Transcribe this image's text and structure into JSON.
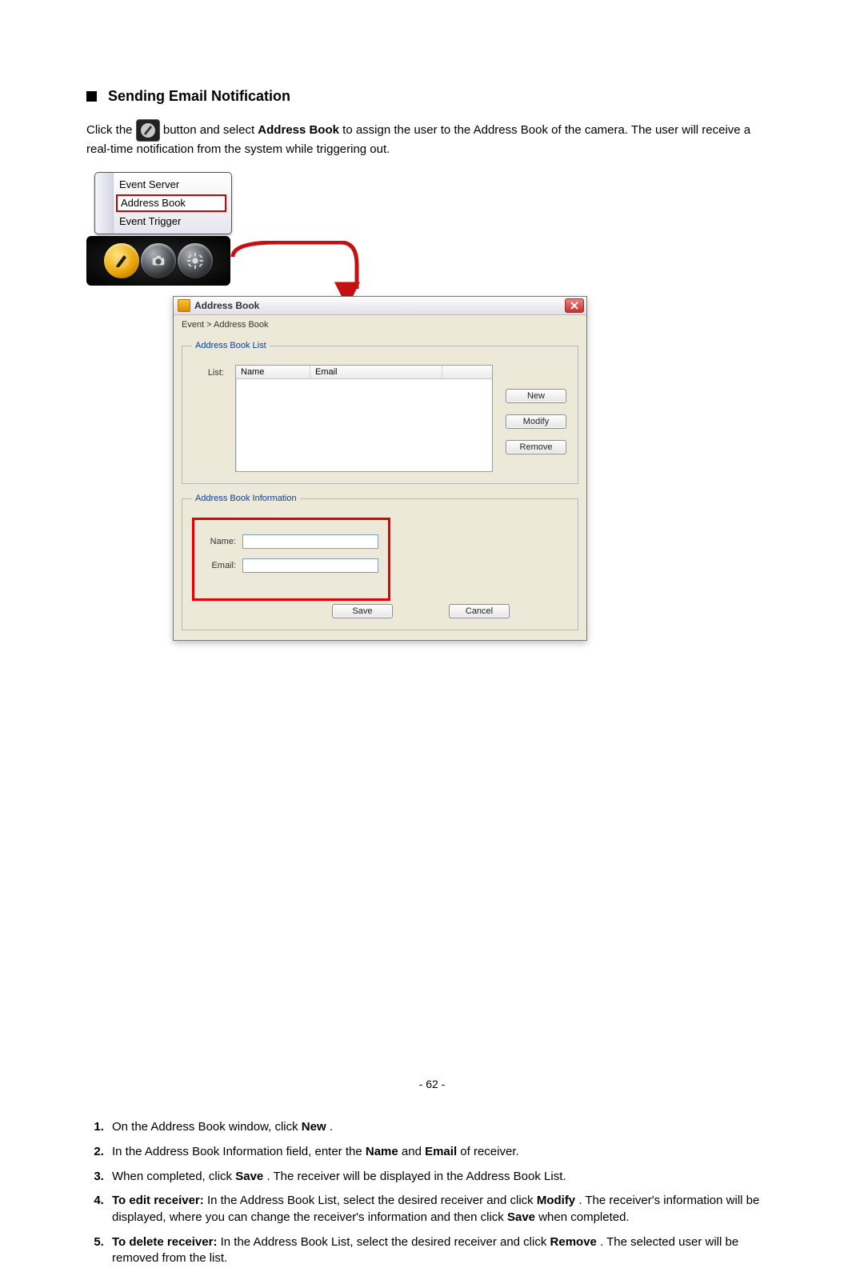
{
  "heading": "Sending Email Notification",
  "intro": {
    "t1": "Click the ",
    "t2": " button and select ",
    "bold1": "Address Book",
    "t3": " to assign the user to the Address Book of the camera. The user will receive a real-time notification from the system while triggering out."
  },
  "menu": {
    "items": [
      "Event Server",
      "Address Book",
      "Event Trigger"
    ],
    "selected": "Address Book"
  },
  "icon_strip": {
    "pen": "pen-icon",
    "camera": "camera-icon",
    "gear": "gear-icon"
  },
  "dialog": {
    "title": "Address Book",
    "breadcrumb": "Event > Address Book",
    "group_list_legend": "Address Book List",
    "list_label": "List:",
    "columns": {
      "name": "Name",
      "email": "Email"
    },
    "buttons": {
      "new": "New",
      "modify": "Modify",
      "remove": "Remove"
    },
    "group_info_legend": "Address Book Information",
    "fields": {
      "name_label": "Name:",
      "email_label": "Email:",
      "name_value": "",
      "email_value": ""
    },
    "bottom": {
      "save": "Save",
      "cancel": "Cancel"
    }
  },
  "steps": {
    "s1a": "On the Address Book window, click ",
    "s1b": "New",
    "s1c": ".",
    "s2a": "In the Address Book Information field, enter the ",
    "s2b": "Name",
    "s2c": " and ",
    "s2d": "Email",
    "s2e": " of receiver.",
    "s3a": "When completed, click ",
    "s3b": "Save",
    "s3c": ". The receiver will be displayed in the Address Book List.",
    "s4a": "To edit receiver:",
    "s4b": " In the Address Book List, select the desired receiver and click ",
    "s4c": "Modify",
    "s4d": ". The receiver's information will be displayed, where you can change the receiver's information and then click ",
    "s4e": "Save",
    "s4f": " when completed.",
    "s5a": "To delete receiver:",
    "s5b": " In the Address Book List, select the desired receiver and click ",
    "s5c": "Remove",
    "s5d": ". The selected user will be removed from the list."
  },
  "page_number": "- 62 -"
}
